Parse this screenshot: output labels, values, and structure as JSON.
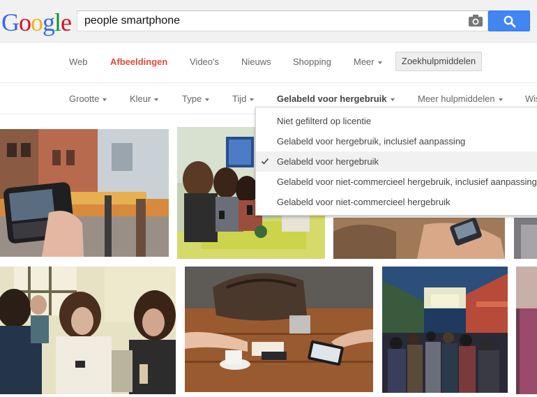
{
  "header": {
    "logo": [
      "G",
      "o",
      "o",
      "g",
      "l",
      "e"
    ],
    "search_value": "people smartphone",
    "camera_icon": "camera-icon",
    "search_icon": "search-icon"
  },
  "nav": {
    "items": [
      {
        "label": "Web"
      },
      {
        "label": "Afbeeldingen",
        "active": true
      },
      {
        "label": "Video's"
      },
      {
        "label": "Nieuws"
      },
      {
        "label": "Shopping"
      },
      {
        "label": "Meer"
      }
    ],
    "tools_label": "Zoekhulpmiddelen"
  },
  "filters": {
    "items": [
      {
        "label": "Grootte"
      },
      {
        "label": "Kleur"
      },
      {
        "label": "Type"
      },
      {
        "label": "Tijd"
      },
      {
        "label": "Gelabeld voor hergebruik",
        "active": true
      },
      {
        "label": "Meer hulpmiddelen"
      },
      {
        "label": "Wis"
      }
    ]
  },
  "dropdown": {
    "options": [
      {
        "label": "Niet gefilterd op licentie"
      },
      {
        "label": "Gelabeld voor hergebruik, inclusief aanpassing"
      },
      {
        "label": "Gelabeld voor hergebruik",
        "selected": true
      },
      {
        "label": "Gelabeld voor niet-commercieel hergebruik, inclusief aanpassing"
      },
      {
        "label": "Gelabeld voor niet-commercieel hergebruik"
      }
    ]
  },
  "colors": {
    "accent_red": "#dd4b39",
    "search_blue": "#4285f4"
  },
  "results": [
    {
      "name": "street-phone-photo"
    },
    {
      "name": "friends-table-photo"
    },
    {
      "name": "hand-phone-photo"
    },
    {
      "name": "edge-photo-1"
    },
    {
      "name": "teens-texting-photo"
    },
    {
      "name": "cafe-table-photo"
    },
    {
      "name": "subway-crowd-photo"
    },
    {
      "name": "edge-photo-2"
    }
  ]
}
